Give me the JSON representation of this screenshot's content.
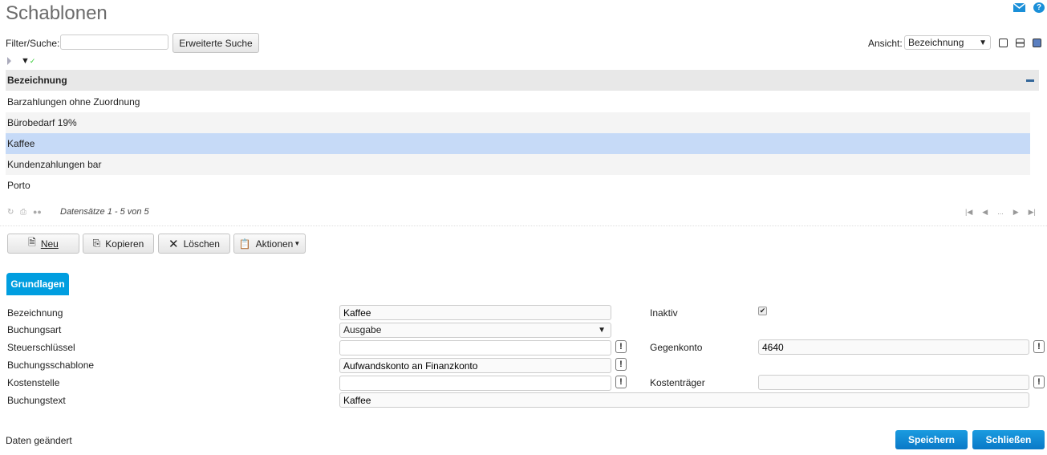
{
  "header": {
    "title": "Schablonen",
    "mail_icon": "mail-icon",
    "help_icon": "help-icon"
  },
  "filter": {
    "label": "Filter/Suche:",
    "value": "",
    "advanced_search": "Erweiterte Suche"
  },
  "view": {
    "label": "Ansicht:",
    "selected": "Bezeichnung"
  },
  "table": {
    "column": "Bezeichnung",
    "rows": [
      "Barzahlungen ohne Zuordnung",
      "Bürobedarf 19%",
      "Kaffee",
      "Kundenzahlungen bar",
      "Porto"
    ],
    "selected_index": 2,
    "records": "Datensätze 1 - 5 von 5",
    "pager_ellipsis": "..."
  },
  "toolbar": {
    "new": "Neu",
    "copy": "Kopieren",
    "delete": "Löschen",
    "actions": "Aktionen"
  },
  "tabs": [
    {
      "label": "Grundlagen",
      "active": true
    }
  ],
  "form": {
    "bezeichnung": {
      "label": "Bezeichnung",
      "value": "Kaffee"
    },
    "buchungsart": {
      "label": "Buchungsart",
      "value": "Ausgabe"
    },
    "steuerschluessel": {
      "label": "Steuerschlüssel",
      "value": ""
    },
    "buchungsschablone": {
      "label": "Buchungsschablone",
      "value": "Aufwandskonto an Finanzkonto"
    },
    "kostenstelle": {
      "label": "Kostenstelle",
      "value": ""
    },
    "buchungstext": {
      "label": "Buchungstext",
      "value": "Kaffee"
    },
    "inaktiv": {
      "label": "Inaktiv",
      "checked": true
    },
    "gegenkonto": {
      "label": "Gegenkonto",
      "value": "4640"
    },
    "kostentraeger": {
      "label": "Kostenträger",
      "value": ""
    },
    "info_button": "!"
  },
  "footer": {
    "status": "Daten geändert",
    "save": "Speichern",
    "close": "Schließen"
  },
  "colors": {
    "accent": "#009ee0",
    "selected_row": "#c6daf7",
    "header_bg": "#e8e8e8"
  }
}
